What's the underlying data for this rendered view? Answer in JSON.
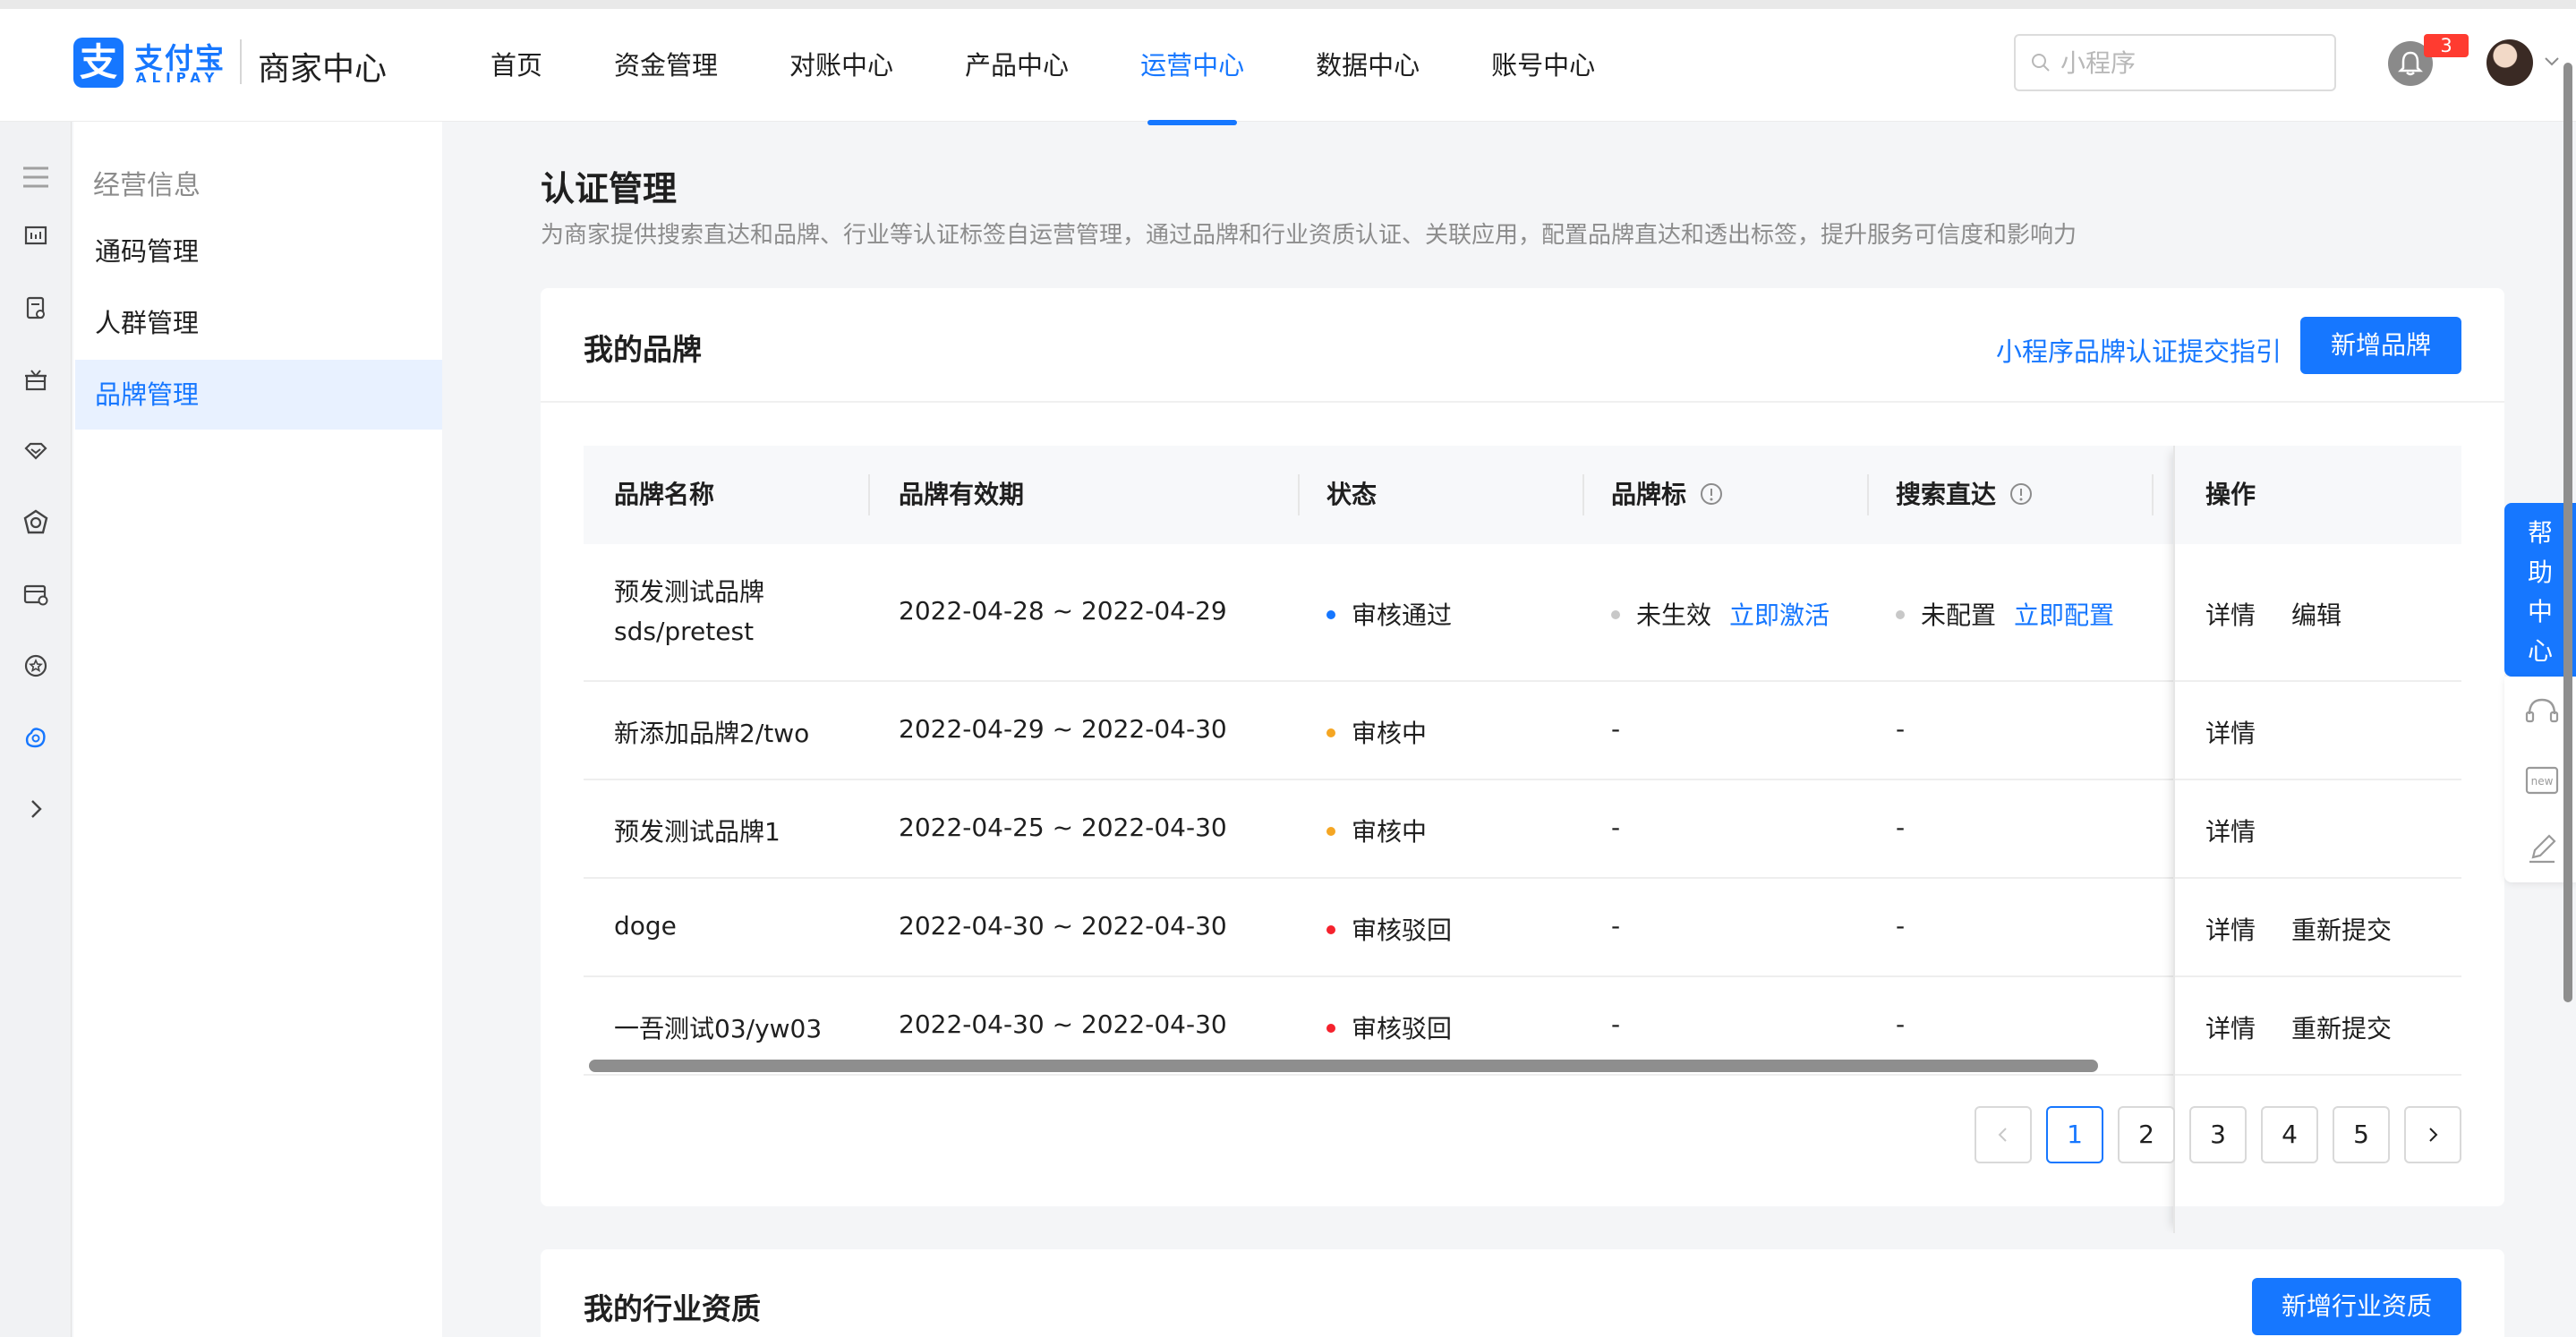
{
  "header": {
    "logo_text": "支付宝",
    "logo_sub": "ALIPAY",
    "title": "商家中心",
    "nav": [
      {
        "label": "首页",
        "active": false
      },
      {
        "label": "资金管理",
        "active": false
      },
      {
        "label": "对账中心",
        "active": false
      },
      {
        "label": "产品中心",
        "active": false
      },
      {
        "label": "运营中心",
        "active": true
      },
      {
        "label": "数据中心",
        "active": false
      },
      {
        "label": "账号中心",
        "active": false
      }
    ],
    "search_placeholder": "小程序",
    "notification_count": "3"
  },
  "sidebar": {
    "section_title": "经营信息",
    "items": [
      {
        "label": "通码管理",
        "active": false
      },
      {
        "label": "人群管理",
        "active": false
      },
      {
        "label": "品牌管理",
        "active": true
      }
    ]
  },
  "page": {
    "title": "认证管理",
    "description": "为商家提供搜索直达和品牌、行业等认证标签自运营管理，通过品牌和行业资质认证、关联应用，配置品牌直达和透出标签，提升服务可信度和影响力"
  },
  "brands_card": {
    "title": "我的品牌",
    "guide_link": "小程序品牌认证提交指引",
    "add_button": "新增品牌",
    "columns": {
      "name": "品牌名称",
      "validity": "品牌有效期",
      "status": "状态",
      "brand_tag": "品牌标",
      "search_direct": "搜索直达",
      "actions": "操作"
    },
    "rows": [
      {
        "name": "预发测试品牌",
        "name_line2": "sds/pretest",
        "validity": "2022-04-28 ~ 2022-04-29",
        "status": "审核通过",
        "status_color": "#1677ff",
        "brand_tag": "未生效",
        "brand_tag_action": "立即激活",
        "search_direct": "未配置",
        "search_direct_action": "立即配置",
        "action1": "详情",
        "action2": "编辑"
      },
      {
        "name": "新添加品牌2/two",
        "name_line2": "",
        "validity": "2022-04-29 ~ 2022-04-30",
        "status": "审核中",
        "status_color": "#f5a623",
        "brand_tag": "-",
        "brand_tag_action": "",
        "search_direct": "-",
        "search_direct_action": "",
        "action1": "详情",
        "action2": ""
      },
      {
        "name": "预发测试品牌1",
        "name_line2": "",
        "validity": "2022-04-25 ~ 2022-04-30",
        "status": "审核中",
        "status_color": "#f5a623",
        "brand_tag": "-",
        "brand_tag_action": "",
        "search_direct": "-",
        "search_direct_action": "",
        "action1": "详情",
        "action2": ""
      },
      {
        "name": "doge",
        "name_line2": "",
        "validity": "2022-04-30 ~ 2022-04-30",
        "status": "审核驳回",
        "status_color": "#f5222d",
        "brand_tag": "-",
        "brand_tag_action": "",
        "search_direct": "-",
        "search_direct_action": "",
        "action1": "详情",
        "action2": "重新提交"
      },
      {
        "name": "一吾测试03/yw03",
        "name_line2": "",
        "validity": "2022-04-30 ~ 2022-04-30",
        "status": "审核驳回",
        "status_color": "#f5222d",
        "brand_tag": "-",
        "brand_tag_action": "",
        "search_direct": "-",
        "search_direct_action": "",
        "action1": "详情",
        "action2": "重新提交"
      }
    ],
    "pagination": {
      "pages": [
        "1",
        "2",
        "3",
        "4",
        "5"
      ],
      "current": "1"
    }
  },
  "industry_card": {
    "title": "我的行业资质",
    "add_button": "新增行业资质"
  },
  "help": {
    "label": "帮助中心",
    "chars": [
      "帮",
      "助",
      "中",
      "心"
    ],
    "new_tag": "new"
  },
  "colors": {
    "primary": "#1677ff",
    "pending": "#f5a623",
    "rejected": "#f5222d",
    "inactive_dot": "#c8c8c8"
  }
}
